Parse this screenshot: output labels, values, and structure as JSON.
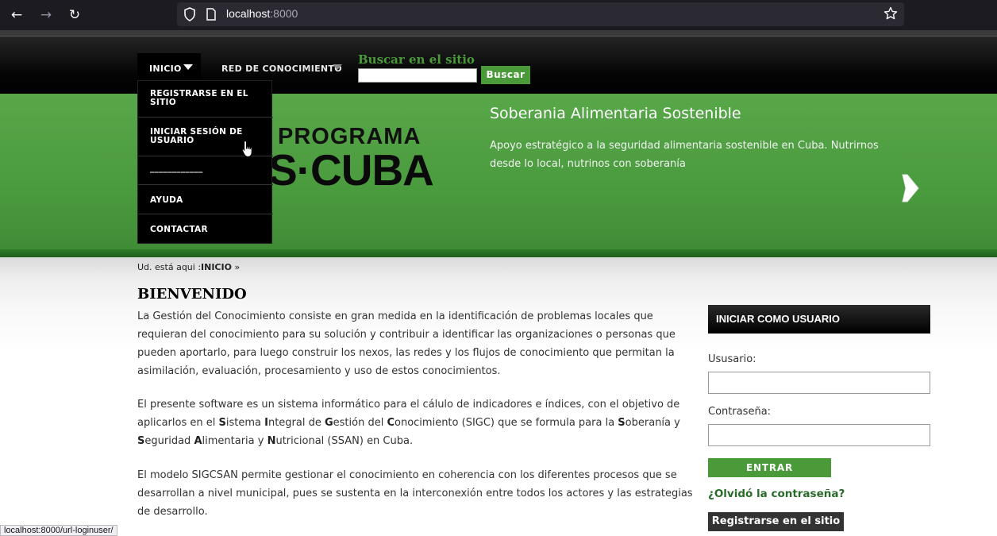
{
  "browser": {
    "url_host": "localhost",
    "url_port": ":8000",
    "status_url": "localhost:8000/url-loginuser/"
  },
  "nav": {
    "inicio": "INICIO",
    "red": "RED DE CONOCIMIENTO",
    "search_title": "Buscar en el sitio",
    "search_button": "Buscar",
    "search_value": ""
  },
  "dropdown": {
    "items": [
      "REGISTRARSE EN EL SITIO",
      "INICIAR SESIÓN DE USUARIO",
      "____________",
      "AYUDA",
      "CONTACTAR"
    ]
  },
  "banner": {
    "logo_line1": "PROGRAMA",
    "logo_line2": "S·CUBA",
    "title": "Soberania Alimentaria Sostenible",
    "description": "Apoyo estratégico a la seguridad alimentaria sostenible en Cuba. Nutrirnos desde lo local, nutrinos con soberanía"
  },
  "breadcrumb": {
    "prefix": "Ud. está aqui :",
    "current": "INICIO",
    "suffix": " »"
  },
  "main": {
    "heading": "BIENVENIDO",
    "para1": "La Gestión del Conocimiento consiste en gran medida en la identificación de problemas locales que requieran del conocimiento para su solución y contribuir a identificar las organizaciones o personas que pueden aportarlo, para luego construir los nexos, las redes y los flujos de conocimiento que permitan la asimilación, evaluación, procesamiento y uso de estos conocimientos.",
    "para2_parts": [
      "El presente software es un sistema informático para el cálulo de indicadores e índices, con el objetivo de aplicarlos en el ",
      "S",
      "istema ",
      "I",
      "ntegral de ",
      "G",
      "estión del ",
      "C",
      "onocimiento (SIGC) que se formula para la ",
      "S",
      "oberanía y ",
      "S",
      "eguridad ",
      "A",
      "limentaria y ",
      "N",
      "utricional (SSAN) en Cuba."
    ],
    "para3": "El modelo SIGCSAN permite gestionar el conocimiento en coherencia con los diferentes procesos que se desarrollan a nivel municipal, pues se sustenta en la interconexión entre todos los actores y las estrategias de desarrollo."
  },
  "login": {
    "header": "INICIAR COMO USUARIO",
    "user_label": "Ususario:",
    "user_value": "",
    "password_label": "Contraseña:",
    "password_value": "",
    "submit": "ENTRAR",
    "forgot": "¿Olvidó la contraseña?",
    "register": "Registrarse en el sitio"
  },
  "colors": {
    "green": "#4a9a3a",
    "dark_green_link": "#2a6a2a",
    "menu_bg": "#000000"
  }
}
